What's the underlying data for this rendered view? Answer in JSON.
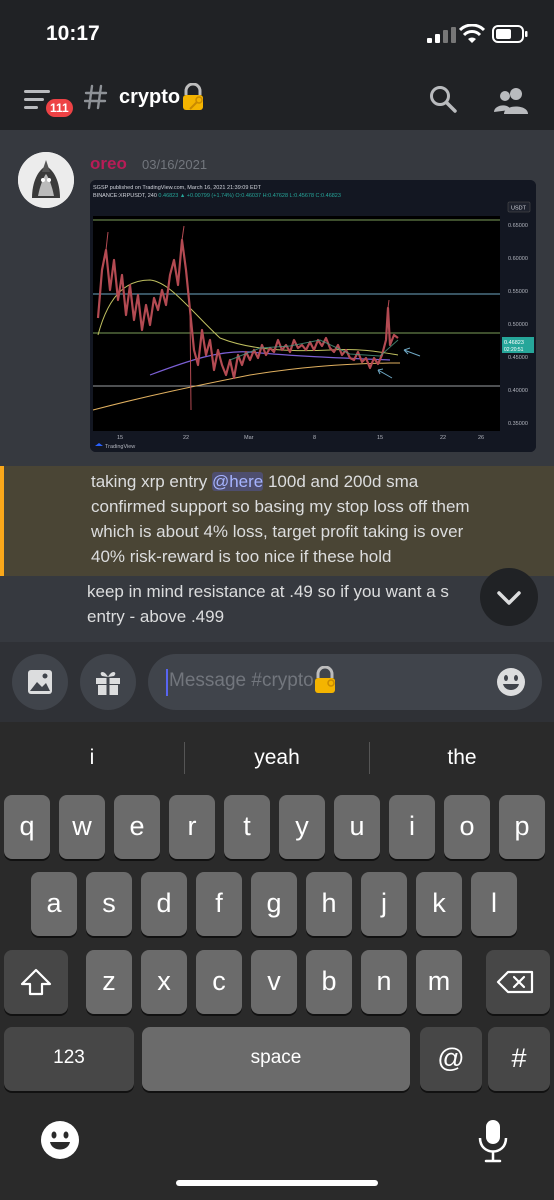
{
  "status": {
    "time": "10:17"
  },
  "header": {
    "badge_count": "111",
    "channel_name": "crypto"
  },
  "message": {
    "author": "oreo",
    "author_color": "#b81c57",
    "timestamp": "03/16/2021",
    "mention_color": "#faa81a",
    "line1_before": "taking xrp entry ",
    "mention": "@here",
    "line1_after": " 100d and 200d sma",
    "line2": "confirmed support so basing my stop loss off them",
    "line3": "which is about 4% loss, target profit taking is over",
    "line4": "40% risk-reward is too nice if these hold",
    "followup_line1": "keep in mind resistance at .49 so if you want a s",
    "followup_line2": "entry - above .499"
  },
  "chart_embed": {
    "published_line": "SGSP published on TradingView.com, March 16, 2021 21:39:09 EDT",
    "symbol_line": "BINANCE:XRPUSDT, 240",
    "quote_line": "0.46823 ▲ +0.00799 (+1.74%) O:0.46037 H:0.47628 L:0.45678 C:0.46823",
    "currency": "USDT",
    "price_ticks": [
      "0.65000",
      "0.60000",
      "0.55000",
      "0.50000",
      "0.45000",
      "0.40000",
      "0.35000"
    ],
    "date_ticks": [
      "15",
      "22",
      "Mar",
      "8",
      "15",
      "22",
      "26"
    ],
    "last_price": "0.46823",
    "last_price_time": "02:20:51",
    "watermark": "TradingView"
  },
  "input": {
    "placeholder": "Message #crypto"
  },
  "keyboard": {
    "suggestions": [
      "i",
      "yeah",
      "the"
    ],
    "row1": [
      "q",
      "w",
      "e",
      "r",
      "t",
      "y",
      "u",
      "i",
      "o",
      "p"
    ],
    "row2": [
      "a",
      "s",
      "d",
      "f",
      "g",
      "h",
      "j",
      "k",
      "l"
    ],
    "row3": [
      "z",
      "x",
      "c",
      "v",
      "b",
      "n",
      "m"
    ],
    "numbers_key": "123",
    "space_key": "space",
    "at_key": "@",
    "hash_key": "#"
  },
  "colors": {
    "accent": "#5865f2",
    "bg": "#36393f",
    "header_bg": "#202225",
    "mention_bg": "#4a4535"
  }
}
